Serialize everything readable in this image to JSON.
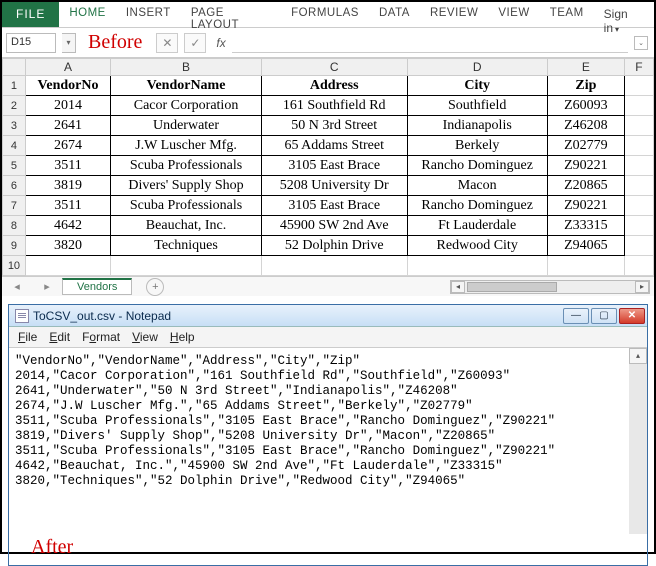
{
  "ribbon": {
    "file": "FILE",
    "tabs": [
      "HOME",
      "INSERT",
      "PAGE LAYOUT",
      "FORMULAS",
      "DATA",
      "REVIEW",
      "VIEW",
      "TEAM"
    ],
    "signin": "Sign in"
  },
  "namebox": "D15",
  "labels": {
    "before": "Before",
    "after": "After",
    "fx": "fx"
  },
  "columns": [
    "A",
    "B",
    "C",
    "D",
    "E",
    "F"
  ],
  "headers": [
    "VendorNo",
    "VendorName",
    "Address",
    "City",
    "Zip"
  ],
  "rows": [
    [
      "2014",
      "Cacor Corporation",
      "161 Southfield Rd",
      "Southfield",
      "Z60093"
    ],
    [
      "2641",
      "Underwater",
      "50 N 3rd Street",
      "Indianapolis",
      "Z46208"
    ],
    [
      "2674",
      "J.W Luscher Mfg.",
      "65 Addams Street",
      "Berkely",
      "Z02779"
    ],
    [
      "3511",
      "Scuba Professionals",
      "3105 East Brace",
      "Rancho Dominguez",
      "Z90221"
    ],
    [
      "3819",
      "Divers' Supply Shop",
      "5208 University Dr",
      "Macon",
      "Z20865"
    ],
    [
      "3511",
      "Scuba Professionals",
      "3105 East Brace",
      "Rancho Dominguez",
      "Z90221"
    ],
    [
      "4642",
      "Beauchat, Inc.",
      "45900 SW 2nd Ave",
      "Ft Lauderdale",
      "Z33315"
    ],
    [
      "3820",
      "Techniques",
      "52 Dolphin Drive",
      "Redwood City",
      "Z94065"
    ]
  ],
  "sheet": {
    "name": "Vendors"
  },
  "notepad": {
    "title": "ToCSV_out.csv - Notepad",
    "menu": [
      "File",
      "Edit",
      "Format",
      "View",
      "Help"
    ],
    "lines": [
      "\"VendorNo\",\"VendorName\",\"Address\",\"City\",\"Zip\"",
      "2014,\"Cacor Corporation\",\"161 Southfield Rd\",\"Southfield\",\"Z60093\"",
      "2641,\"Underwater\",\"50 N 3rd Street\",\"Indianapolis\",\"Z46208\"",
      "2674,\"J.W Luscher Mfg.\",\"65 Addams Street\",\"Berkely\",\"Z02779\"",
      "3511,\"Scuba Professionals\",\"3105 East Brace\",\"Rancho Dominguez\",\"Z90221\"",
      "3819,\"Divers' Supply Shop\",\"5208 University Dr\",\"Macon\",\"Z20865\"",
      "3511,\"Scuba Professionals\",\"3105 East Brace\",\"Rancho Dominguez\",\"Z90221\"",
      "4642,\"Beauchat, Inc.\",\"45900 SW 2nd Ave\",\"Ft Lauderdale\",\"Z33315\"",
      "3820,\"Techniques\",\"52 Dolphin Drive\",\"Redwood City\",\"Z94065\""
    ]
  }
}
